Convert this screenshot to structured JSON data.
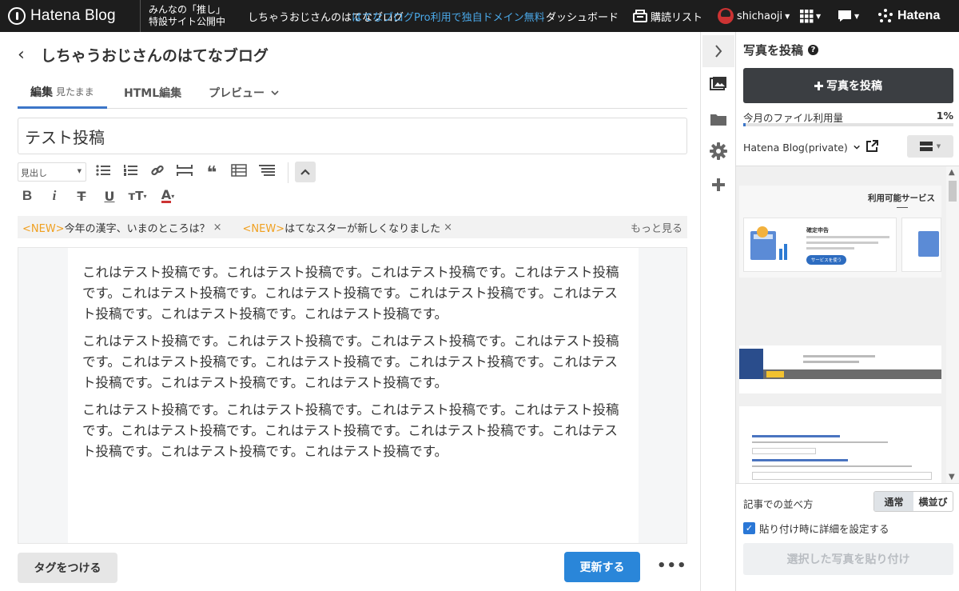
{
  "topbar": {
    "logo_text": "Hatena Blog",
    "promo_line1": "みんなの「推し」",
    "promo_line2": "特設サイト公開中",
    "blog_link": "しちゃうおじさんのはてなブログ",
    "pro_link": "はてなブログPro利用で独自ドメイン無料",
    "dashboard": "ダッシュボード",
    "subscriptions": "購読リスト",
    "username": "shichaoji",
    "brand": "Hatena"
  },
  "editor": {
    "back_icon": "chevron-left-icon",
    "blog_title": "しちゃうおじさんのはてなブログ",
    "tabs": [
      {
        "label": "編集",
        "sub": "見たまま"
      },
      {
        "label": "HTML編集"
      },
      {
        "label": "プレビュー"
      }
    ],
    "post_title": "テスト投稿",
    "heading_select": "見出し",
    "news": [
      {
        "tag": "<NEW>",
        "text": "今年の漢字、いまのところは？"
      },
      {
        "tag": "<NEW>",
        "text": "はてなスターが新しくなりました"
      }
    ],
    "news_more": "もっと見る",
    "paragraphs": [
      "これはテスト投稿です。これはテスト投稿です。これはテスト投稿です。これはテスト投稿です。これはテスト投稿です。これはテスト投稿です。これはテスト投稿です。これはテスト投稿です。これはテスト投稿です。これはテスト投稿です。",
      "これはテスト投稿です。これはテスト投稿です。これはテスト投稿です。これはテスト投稿です。これはテスト投稿です。これはテスト投稿です。これはテスト投稿です。これはテスト投稿です。これはテスト投稿です。これはテスト投稿です。",
      "これはテスト投稿です。これはテスト投稿です。これはテスト投稿です。これはテスト投稿です。これはテスト投稿です。これはテスト投稿です。これはテスト投稿です。これはテスト投稿です。これはテスト投稿です。これはテスト投稿です。"
    ],
    "tag_button": "タグをつける",
    "update_button": "更新する"
  },
  "panel": {
    "title": "写真を投稿",
    "upload_button": "写真を投稿",
    "usage_label": "今月のファイル利用量",
    "usage_percent": "1%",
    "usage_fraction": 0.01,
    "blog_select": "Hatena Blog(private)",
    "thumb1_header": "利用可能サービス",
    "thumb1_card": "確定申告",
    "thumb1_button": "サービスを使う",
    "sort_label": "記事での並べ方",
    "sort_options": [
      "通常",
      "横並び"
    ],
    "detail_checkbox": "貼り付け時に詳細を設定する",
    "paste_button": "選択した写真を貼り付け"
  },
  "colors": {
    "accent": "#2a86d9",
    "topbar": "#1d1d1d",
    "new_tag": "#f0a020"
  }
}
